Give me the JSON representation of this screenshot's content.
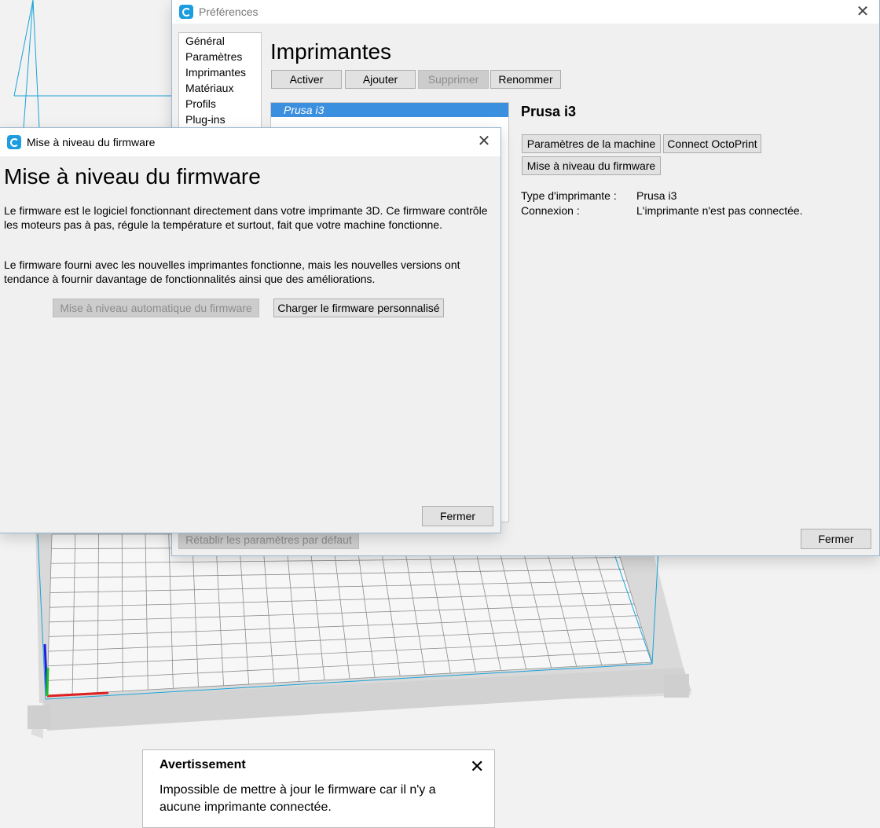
{
  "preferences": {
    "title": "Préférences",
    "sidebar": [
      "Général",
      "Paramètres",
      "Imprimantes",
      "Matériaux",
      "Profils",
      "Plug-ins"
    ],
    "heading": "Imprimantes",
    "toolbar": {
      "activate": "Activer",
      "add": "Ajouter",
      "remove": "Supprimer",
      "rename": "Renommer"
    },
    "printers": [
      "Prusa i3"
    ],
    "selected_name": "Prusa i3",
    "machine_settings": "Paramètres de la machine",
    "connect_octoprint": "Connect OctoPrint",
    "firmware_upgrade": "Mise à niveau du firmware",
    "type_label": "Type d'imprimante :",
    "type_value": "Prusa i3",
    "connection_label": "Connexion :",
    "connection_value": "L'imprimante n'est pas connectée.",
    "reset": "Rétablir les paramètres par défaut",
    "close": "Fermer"
  },
  "firmware_dialog": {
    "title": "Mise à niveau du firmware",
    "heading": "Mise à niveau du firmware",
    "para1": "Le firmware est le logiciel fonctionnant directement dans votre imprimante 3D. Ce firmware contrôle les moteurs pas à pas, régule la température et surtout, fait que votre machine fonctionne.",
    "para2": "Le firmware fourni avec les nouvelles imprimantes fonctionne, mais les nouvelles versions ont tendance à fournir davantage de fonctionnalités ainsi que des améliorations.",
    "auto_upgrade": "Mise à niveau automatique du firmware",
    "custom_upload": "Charger le firmware personnalisé",
    "close": "Fermer"
  },
  "toast": {
    "title": "Avertissement",
    "message": "Impossible de mettre à jour le firmware car il n'y a aucune imprimante connectée."
  },
  "colors": {
    "accent": "#3a8fde",
    "build_volume": "#1aa3d9",
    "axis_x": "#e02020",
    "axis_y": "#20c020",
    "axis_z": "#2020e0"
  }
}
